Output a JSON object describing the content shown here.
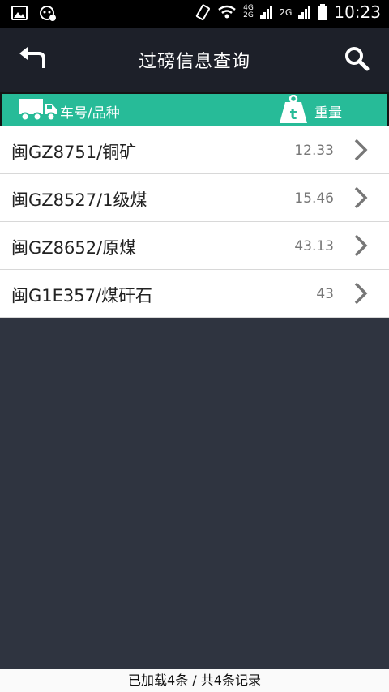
{
  "status_bar": {
    "time": "10:23",
    "net_top": "4G",
    "net_bottom": "2G",
    "net_label": "2G"
  },
  "appbar": {
    "title": "过磅信息查询"
  },
  "table_header": {
    "col_vehicle": "车号/品种",
    "col_weight": "重量",
    "weight_icon_letter": "t"
  },
  "rows": [
    {
      "label": "闽GZ8751/铜矿",
      "value": "12.33"
    },
    {
      "label": "闽GZ8527/1级煤",
      "value": "15.46"
    },
    {
      "label": "闽GZ8652/原煤",
      "value": "43.13"
    },
    {
      "label": "闽G1E357/煤矸石",
      "value": "43"
    }
  ],
  "footer": {
    "text": "已加载4条 / 共4条记录"
  },
  "colors": {
    "accent": "#27bb98",
    "appbar": "#1d2029",
    "background": "#2f3440"
  }
}
